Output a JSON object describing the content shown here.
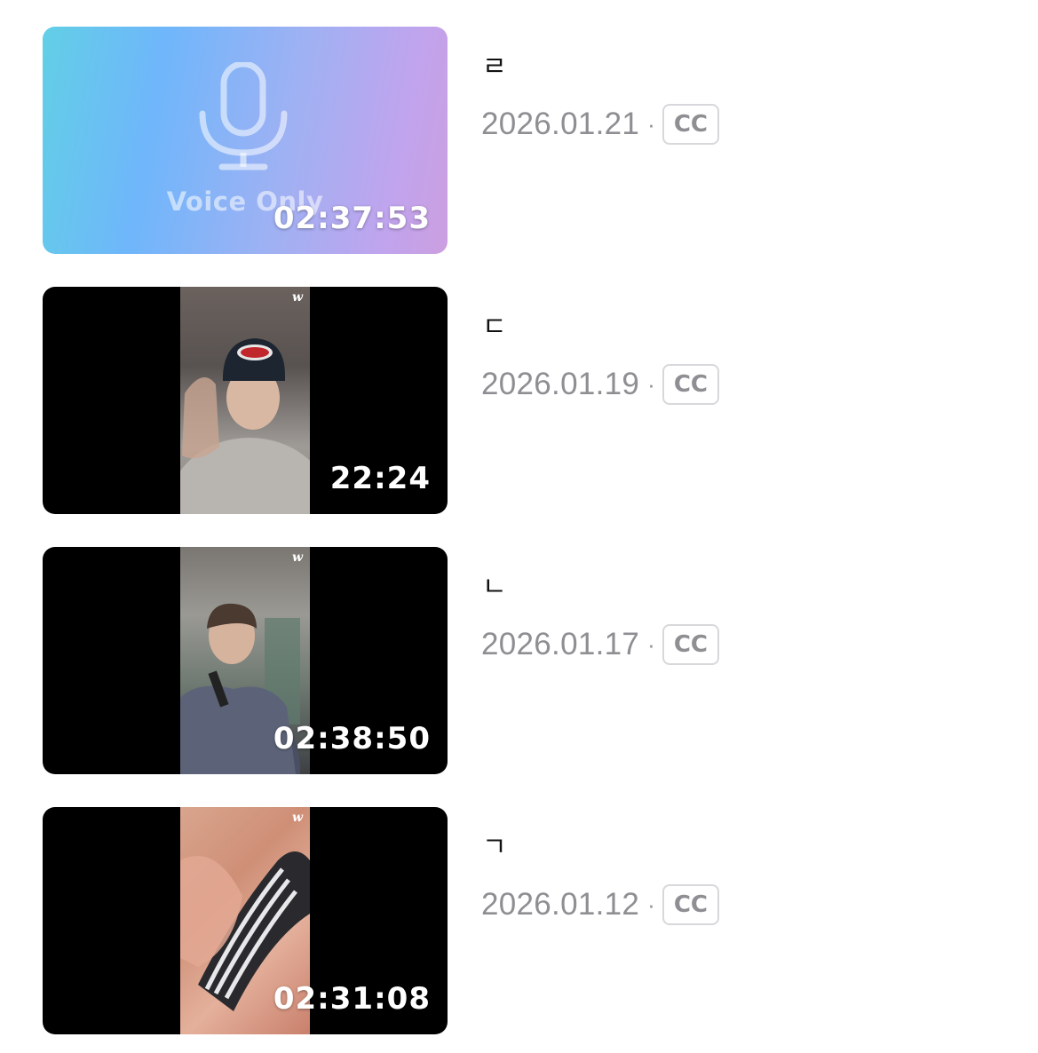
{
  "videos": [
    {
      "title": "ㄹ",
      "date": "2026.01.21",
      "separator": "·",
      "badge": "CC",
      "duration": "02:37:53",
      "type": "voice",
      "voice_label": "Voice Only",
      "icon": "microphone-icon"
    },
    {
      "title": "ㄷ",
      "date": "2026.01.19",
      "separator": "·",
      "badge": "CC",
      "duration": "22:24",
      "type": "video",
      "watermark": "w"
    },
    {
      "title": "ㄴ",
      "date": "2026.01.17",
      "separator": "·",
      "badge": "CC",
      "duration": "02:38:50",
      "type": "video",
      "watermark": "w"
    },
    {
      "title": "ㄱ",
      "date": "2026.01.12",
      "separator": "·",
      "badge": "CC",
      "duration": "02:31:08",
      "type": "video",
      "watermark": "w"
    }
  ],
  "colors": {
    "meta_text": "#8e8e93",
    "badge_border": "#d8d8dc",
    "thumb_bg": "#000000"
  }
}
